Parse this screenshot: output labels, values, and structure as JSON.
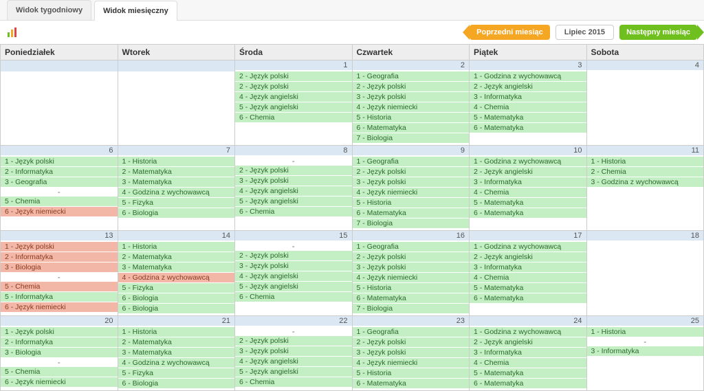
{
  "tabs": {
    "weekly": "Widok tygodniowy",
    "monthly": "Widok miesięczny"
  },
  "nav": {
    "prev": "Poprzedni miesiąc",
    "month": "Lipiec 2015",
    "next": "Następny miesiąc"
  },
  "headers": {
    "mon": "Poniedziałek",
    "tue": "Wtorek",
    "wed": "Środa",
    "thu": "Czwartek",
    "fri": "Piątek",
    "sat": "Sobota"
  },
  "icons": {
    "chart": "chart-icon"
  },
  "cells": {
    "w1": {
      "mon": {
        "day": "",
        "events": []
      },
      "tue": {
        "day": "",
        "events": []
      },
      "wed": {
        "day": "1",
        "events": [
          {
            "t": "2 - Język polski",
            "c": "green"
          },
          {
            "t": "2 - Język polski",
            "c": "green"
          },
          {
            "t": "4 - Język angielski",
            "c": "green"
          },
          {
            "t": "5 - Język angielski",
            "c": "green"
          },
          {
            "t": "6 - Chemia",
            "c": "green"
          }
        ]
      },
      "thu": {
        "day": "2",
        "events": [
          {
            "t": "1 - Geografia",
            "c": "green"
          },
          {
            "t": "2 - Język polski",
            "c": "green"
          },
          {
            "t": "3 - Język polski",
            "c": "green"
          },
          {
            "t": "4 - Język niemiecki",
            "c": "green"
          },
          {
            "t": "5 - Historia",
            "c": "green"
          },
          {
            "t": "6 - Matematyka",
            "c": "green"
          },
          {
            "t": "7 - Biologia",
            "c": "green"
          }
        ]
      },
      "fri": {
        "day": "3",
        "events": [
          {
            "t": "1 - Godzina z wychowawcą",
            "c": "green"
          },
          {
            "t": "2 - Język angielski",
            "c": "green"
          },
          {
            "t": "3 - Informatyka",
            "c": "green"
          },
          {
            "t": "4 - Chemia",
            "c": "green"
          },
          {
            "t": "5 - Matematyka",
            "c": "green"
          },
          {
            "t": "6 - Matematyka",
            "c": "green"
          }
        ]
      },
      "sat": {
        "day": "4",
        "events": []
      }
    },
    "w2": {
      "mon": {
        "day": "6",
        "events": [
          {
            "t": "1 - Język polski",
            "c": "green"
          },
          {
            "t": "2 - Informatyka",
            "c": "green"
          },
          {
            "t": "3 - Geografia",
            "c": "green"
          },
          {
            "t": "-",
            "c": "dash"
          },
          {
            "t": "5 - Chemia",
            "c": "green"
          },
          {
            "t": "6 - Język niemiecki",
            "c": "red"
          }
        ]
      },
      "tue": {
        "day": "7",
        "events": [
          {
            "t": "1 - Historia",
            "c": "green"
          },
          {
            "t": "2 - Matematyka",
            "c": "green"
          },
          {
            "t": "3 - Matematyka",
            "c": "green"
          },
          {
            "t": "4 - Godzina z wychowawcą",
            "c": "green"
          },
          {
            "t": "5 - Fizyka",
            "c": "green"
          },
          {
            "t": "6 - Biologia",
            "c": "green"
          }
        ]
      },
      "wed": {
        "day": "8",
        "events": [
          {
            "t": "-",
            "c": "dash"
          },
          {
            "t": "2 - Język polski",
            "c": "green"
          },
          {
            "t": "3 - Język polski",
            "c": "green"
          },
          {
            "t": "4 - Język angielski",
            "c": "green"
          },
          {
            "t": "5 - Język angielski",
            "c": "green"
          },
          {
            "t": "6 - Chemia",
            "c": "green"
          }
        ]
      },
      "thu": {
        "day": "9",
        "events": [
          {
            "t": "1 - Geografia",
            "c": "green"
          },
          {
            "t": "2 - Język polski",
            "c": "green"
          },
          {
            "t": "3 - Język polski",
            "c": "green"
          },
          {
            "t": "4 - Język niemiecki",
            "c": "green"
          },
          {
            "t": "5 - Historia",
            "c": "green"
          },
          {
            "t": "6 - Matematyka",
            "c": "green"
          },
          {
            "t": "7 - Biologia",
            "c": "green"
          }
        ]
      },
      "fri": {
        "day": "10",
        "events": [
          {
            "t": "1 - Godzina z wychowawcą",
            "c": "green"
          },
          {
            "t": "2 - Język angielski",
            "c": "green"
          },
          {
            "t": "3 - Informatyka",
            "c": "green"
          },
          {
            "t": "4 - Chemia",
            "c": "green"
          },
          {
            "t": "5 - Matematyka",
            "c": "green"
          },
          {
            "t": "6 - Matematyka",
            "c": "green"
          }
        ]
      },
      "sat": {
        "day": "11",
        "events": [
          {
            "t": "1 - Historia",
            "c": "green"
          },
          {
            "t": "2 - Chemia",
            "c": "green"
          },
          {
            "t": "3 - Godzina z wychowawcą",
            "c": "green"
          }
        ]
      }
    },
    "w3": {
      "mon": {
        "day": "13",
        "events": [
          {
            "t": "1 - Język polski",
            "c": "red"
          },
          {
            "t": "2 - Informatyka",
            "c": "red"
          },
          {
            "t": "3 - Biologia",
            "c": "red"
          },
          {
            "t": "-",
            "c": "dash"
          },
          {
            "t": "5 - Chemia",
            "c": "red"
          },
          {
            "t": "5 - Informatyka",
            "c": "green"
          },
          {
            "t": "6 - Język niemiecki",
            "c": "red"
          }
        ]
      },
      "tue": {
        "day": "14",
        "events": [
          {
            "t": "1 - Historia",
            "c": "green"
          },
          {
            "t": "2 - Matematyka",
            "c": "green"
          },
          {
            "t": "3 - Matematyka",
            "c": "green"
          },
          {
            "t": "4 - Godzina z wychowawcą",
            "c": "red"
          },
          {
            "t": "5 - Fizyka",
            "c": "green"
          },
          {
            "t": "6 - Biologia",
            "c": "green"
          },
          {
            "t": "6 - Biologia",
            "c": "green"
          }
        ]
      },
      "wed": {
        "day": "15",
        "events": [
          {
            "t": "-",
            "c": "dash"
          },
          {
            "t": "2 - Język polski",
            "c": "green"
          },
          {
            "t": "3 - Język polski",
            "c": "green"
          },
          {
            "t": "4 - Język angielski",
            "c": "green"
          },
          {
            "t": "5 - Język angielski",
            "c": "green"
          },
          {
            "t": "6 - Chemia",
            "c": "green"
          }
        ]
      },
      "thu": {
        "day": "16",
        "events": [
          {
            "t": "1 - Geografia",
            "c": "green"
          },
          {
            "t": "2 - Język polski",
            "c": "green"
          },
          {
            "t": "3 - Język polski",
            "c": "green"
          },
          {
            "t": "4 - Język niemiecki",
            "c": "green"
          },
          {
            "t": "5 - Historia",
            "c": "green"
          },
          {
            "t": "6 - Matematyka",
            "c": "green"
          },
          {
            "t": "7 - Biologia",
            "c": "green"
          }
        ]
      },
      "fri": {
        "day": "17",
        "events": [
          {
            "t": "1 - Godzina z wychowawcą",
            "c": "green"
          },
          {
            "t": "2 - Język angielski",
            "c": "green"
          },
          {
            "t": "3 - Informatyka",
            "c": "green"
          },
          {
            "t": "4 - Chemia",
            "c": "green"
          },
          {
            "t": "5 - Matematyka",
            "c": "green"
          },
          {
            "t": "6 - Matematyka",
            "c": "green"
          }
        ]
      },
      "sat": {
        "day": "18",
        "events": []
      }
    },
    "w4": {
      "mon": {
        "day": "20",
        "events": [
          {
            "t": "1 - Język polski",
            "c": "green"
          },
          {
            "t": "2 - Informatyka",
            "c": "green"
          },
          {
            "t": "3 - Biologia",
            "c": "green"
          },
          {
            "t": "-",
            "c": "dash"
          },
          {
            "t": "5 - Chemia",
            "c": "green"
          },
          {
            "t": "6 - Język niemiecki",
            "c": "green"
          }
        ]
      },
      "tue": {
        "day": "21",
        "events": [
          {
            "t": "1 - Historia",
            "c": "green"
          },
          {
            "t": "2 - Matematyka",
            "c": "green"
          },
          {
            "t": "3 - Matematyka",
            "c": "green"
          },
          {
            "t": "4 - Godzina z wychowawcą",
            "c": "green"
          },
          {
            "t": "5 - Fizyka",
            "c": "green"
          },
          {
            "t": "6 - Biologia",
            "c": "green"
          }
        ]
      },
      "wed": {
        "day": "22",
        "events": [
          {
            "t": "-",
            "c": "dash"
          },
          {
            "t": "2 - Język polski",
            "c": "green"
          },
          {
            "t": "3 - Język polski",
            "c": "green"
          },
          {
            "t": "4 - Język angielski",
            "c": "green"
          },
          {
            "t": "5 - Język angielski",
            "c": "green"
          },
          {
            "t": "6 - Chemia",
            "c": "green"
          }
        ]
      },
      "thu": {
        "day": "23",
        "events": [
          {
            "t": "1 - Geografia",
            "c": "green"
          },
          {
            "t": "2 - Język polski",
            "c": "green"
          },
          {
            "t": "3 - Język polski",
            "c": "green"
          },
          {
            "t": "4 - Język niemiecki",
            "c": "green"
          },
          {
            "t": "5 - Historia",
            "c": "green"
          },
          {
            "t": "6 - Matematyka",
            "c": "green"
          }
        ]
      },
      "fri": {
        "day": "24",
        "events": [
          {
            "t": "1 - Godzina z wychowawcą",
            "c": "green"
          },
          {
            "t": "2 - Język angielski",
            "c": "green"
          },
          {
            "t": "3 - Informatyka",
            "c": "green"
          },
          {
            "t": "4 - Chemia",
            "c": "green"
          },
          {
            "t": "5 - Matematyka",
            "c": "green"
          },
          {
            "t": "6 - Matematyka",
            "c": "green"
          }
        ]
      },
      "sat": {
        "day": "25",
        "events": [
          {
            "t": "1 - Historia",
            "c": "green"
          },
          {
            "t": "-",
            "c": "dash"
          },
          {
            "t": "3 - Informatyka",
            "c": "green"
          }
        ]
      }
    }
  }
}
